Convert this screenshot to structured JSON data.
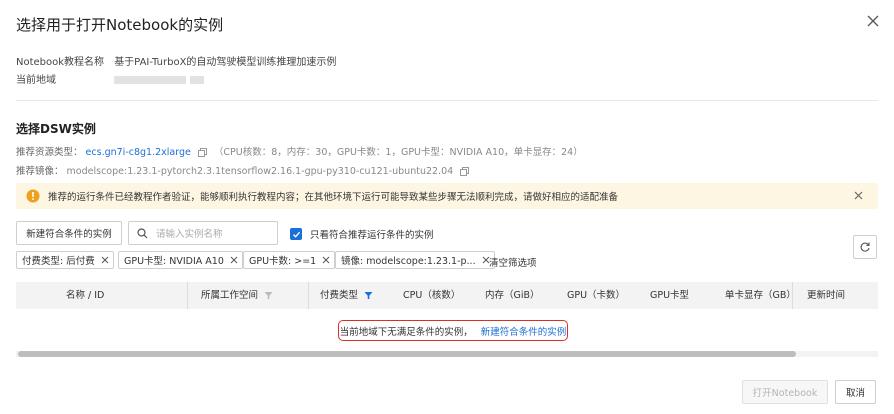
{
  "dialog": {
    "title": "选择用于打开Notebook的实例"
  },
  "info": {
    "notebook_label": "Notebook教程名称",
    "notebook_value": "基于PAI-TurboX的自动驾驶模型训练推理加速示例",
    "region_label": "当前地域"
  },
  "section": {
    "title": "选择DSW实例"
  },
  "recommend": {
    "resource_label": "推荐资源类型：",
    "resource_value": "ecs.gn7i-c8g1.2xlarge",
    "resource_specs": "（CPU核数：8，内存：30，GPU卡数：1，GPU卡型：NVIDIA A10，单卡显存：24）",
    "image_label": "推荐镜像：",
    "image_value": "modelscope:1.23.1-pytorch2.3.1tensorflow2.16.1-gpu-py310-cu121-ubuntu22.04"
  },
  "alert": {
    "text": "推荐的运行条件已经教程作者验证，能够顺利执行教程内容；在其他环境下运行可能导致某些步骤无法顺利完成，请做好相应的适配准备"
  },
  "toolbar": {
    "create_label": "新建符合条件的实例",
    "search_placeholder": "请输入实例名称",
    "only_recommended_label": "只看符合推荐运行条件的实例",
    "only_recommended_checked": true
  },
  "filters": {
    "tags": [
      "付费类型: 后付费",
      "GPU卡型: NVIDIA A10",
      "GPU卡数: >=1",
      "镜像: modelscope:1.23.1-p..."
    ],
    "clear_label": "清空筛选项"
  },
  "table": {
    "columns": [
      "名称 / ID",
      "所属工作空间",
      "付费类型",
      "CPU（核数）",
      "内存（GiB）",
      "GPU（卡数）",
      "GPU卡型",
      "单卡显存（GB）",
      "更新时间"
    ],
    "empty_text": "当前地域下无满足条件的实例，",
    "empty_link": "新建符合条件的实例"
  },
  "footer": {
    "open_label": "打开Notebook",
    "cancel_label": "取消"
  },
  "colors": {
    "accent": "#1b6fd8",
    "warning_bg": "#fdf6e3",
    "warning_icon": "#f0a020",
    "highlight_border": "#d93025"
  }
}
